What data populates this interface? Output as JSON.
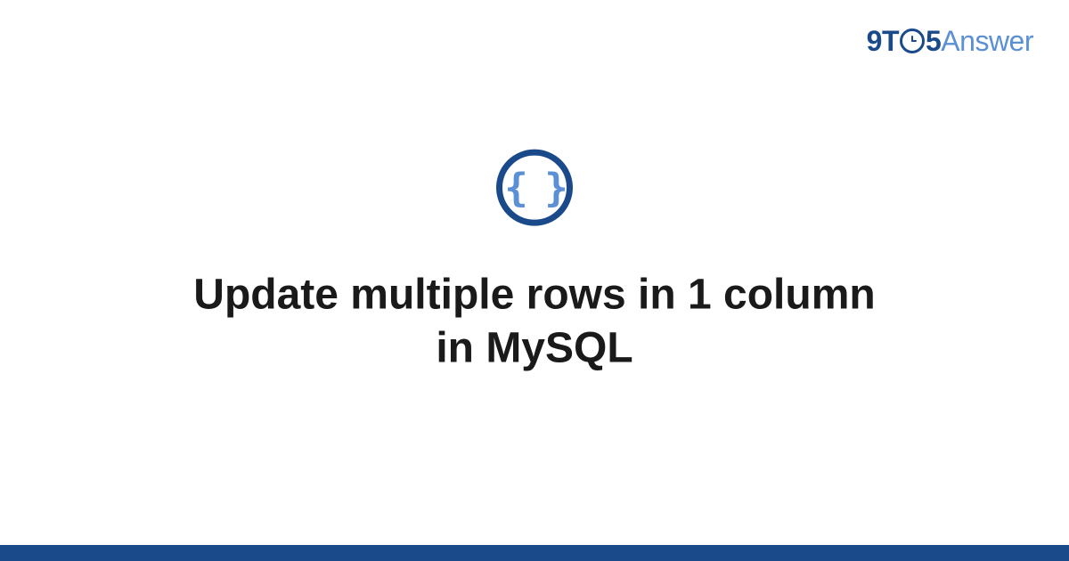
{
  "logo": {
    "part1": "9T",
    "clock": "⏱",
    "part2": "5",
    "part3": "Answer"
  },
  "icon": {
    "symbol": "{ }",
    "name": "code-braces-icon"
  },
  "title": "Update multiple rows in 1 column in MySQL",
  "colors": {
    "primary": "#1a4a8a",
    "accent": "#5b8fd6"
  }
}
